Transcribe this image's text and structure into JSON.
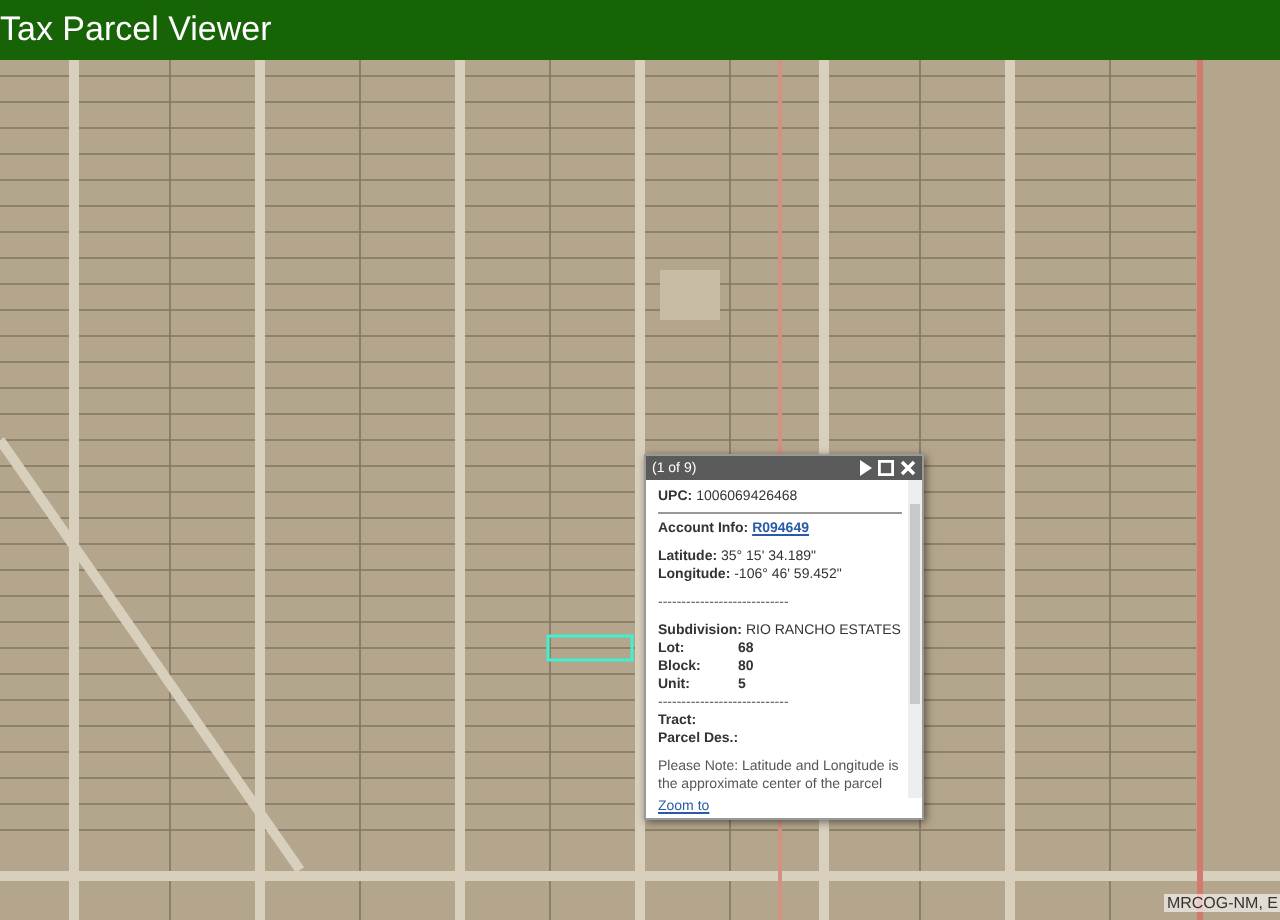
{
  "header": {
    "title": "Tax Parcel Viewer"
  },
  "popup": {
    "counter": "(1 of 9)",
    "lines": [
      {
        "kind": "field",
        "label": "UPC:",
        "value": "1006069426468"
      },
      {
        "kind": "rule"
      },
      {
        "kind": "link",
        "label": "Account Info:",
        "value": "R094649"
      },
      {
        "kind": "gap"
      },
      {
        "kind": "field",
        "label": "Latitude:",
        "value": "35° 15' 34.189\""
      },
      {
        "kind": "field",
        "label": "Longitude:",
        "value": "-106° 46' 59.452\""
      },
      {
        "kind": "gap"
      },
      {
        "kind": "text",
        "value": "----------------------------"
      },
      {
        "kind": "gap"
      },
      {
        "kind": "field",
        "label": "Subdivision:",
        "value": "RIO RANCHO ESTATES"
      },
      {
        "kind": "pair",
        "label": "Lot:",
        "value": "68"
      },
      {
        "kind": "pair",
        "label": "Block:",
        "value": "80"
      },
      {
        "kind": "pair",
        "label": "Unit:",
        "value": "5"
      },
      {
        "kind": "text",
        "value": "----------------------------"
      },
      {
        "kind": "field",
        "label": "Tract:"
      },
      {
        "kind": "field",
        "label": "Parcel Des.:"
      },
      {
        "kind": "gap"
      },
      {
        "kind": "note",
        "value": "Please Note: Latitude and Longitude is the approximate center of the parcel"
      }
    ],
    "footer_link": "Zoom to"
  },
  "attribution": "MRCOG-NM, E"
}
